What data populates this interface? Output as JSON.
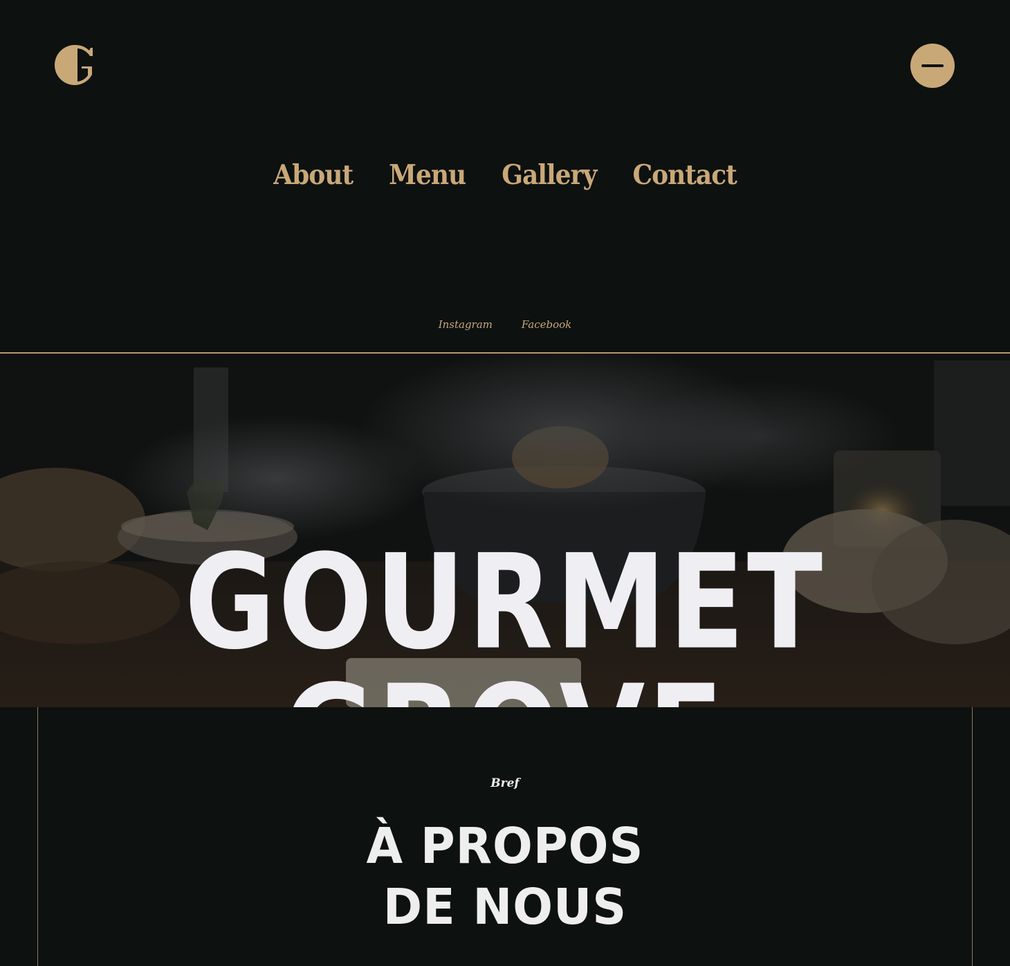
{
  "header": {
    "logo_icon": "g-monogram-icon",
    "menu_icon": "menu-minus-icon",
    "accent_color": "#c9a878"
  },
  "nav": {
    "items": [
      {
        "label": "About"
      },
      {
        "label": "Menu"
      },
      {
        "label": "Gallery"
      },
      {
        "label": "Contact"
      }
    ]
  },
  "socials": {
    "instagram": "Instagram",
    "facebook": "Facebook"
  },
  "hero": {
    "title": "GOURMET GROVE"
  },
  "about": {
    "kicker": "Bref",
    "title_line1": "À PROPOS",
    "title_line2": "DE NOUS"
  }
}
